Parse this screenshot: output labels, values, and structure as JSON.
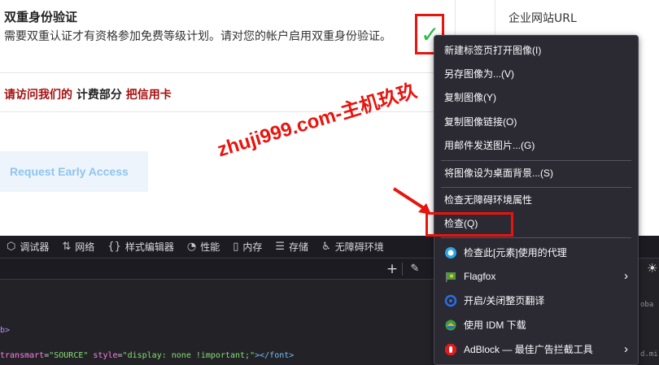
{
  "page": {
    "twofa_title": "双重身份验证",
    "twofa_desc": "需要双重认证才有资格参加免费等级计划。请对您的帐户启用双重身份验证。",
    "checkmark": "✓",
    "url_label": "企业网站URL",
    "billing_part1": "请访问我们的",
    "billing_part2": " 计费部分 ",
    "billing_part3": "把信用卡",
    "early_access": "Request Early Access",
    "watermark": "zhuji999.com-主机玖玖"
  },
  "devtools": {
    "tabs": [
      {
        "icon": "debugger-icon",
        "label": "调试器"
      },
      {
        "icon": "network-icon",
        "label": "网络"
      },
      {
        "icon": "style-editor-icon",
        "label": "样式编辑器"
      },
      {
        "icon": "performance-icon",
        "label": "性能"
      },
      {
        "icon": "memory-icon",
        "label": "内存"
      },
      {
        "icon": "storage-icon",
        "label": "存储"
      },
      {
        "icon": "accessibility-icon",
        "label": "无障碍环境"
      }
    ],
    "code_line1": "b>",
    "code_line2_attr1": "transmart",
    "code_line2_val1": "\"SOURCE\"",
    "code_line2_attr2": " style",
    "code_line2_val2": "\"display: none !important;\"",
    "code_line2_tail": "></font>",
    "right_text1": "oba",
    "right_text2": "d.mi"
  },
  "context_menu": {
    "items": [
      {
        "label": "新建标签页打开图像(I)"
      },
      {
        "label": "另存图像为...(V)"
      },
      {
        "label": "复制图像(Y)"
      },
      {
        "label": "复制图像链接(O)"
      },
      {
        "label": "用邮件发送图片...(G)"
      },
      {
        "label": "将图像设为桌面背景...(S)"
      },
      {
        "label": "检查无障碍环境属性"
      },
      {
        "label": "检查(Q)"
      },
      {
        "label": "检查此[元素]使用的代理",
        "icon": "proxy-icon"
      },
      {
        "label": "Flagfox",
        "icon": "flagfox-icon",
        "submenu": true
      },
      {
        "label": "开启/关闭整页翻译",
        "icon": "translate-icon"
      },
      {
        "label": "使用 IDM 下载",
        "icon": "idm-icon"
      },
      {
        "label": "AdBlock — 最佳广告拦截工具",
        "icon": "adblock-icon",
        "submenu": true
      }
    ]
  },
  "colors": {
    "highlight_red": "#e8140e",
    "check_green": "#2fb84b",
    "menu_bg": "#2b2a33",
    "devtools_bg": "#232327"
  }
}
